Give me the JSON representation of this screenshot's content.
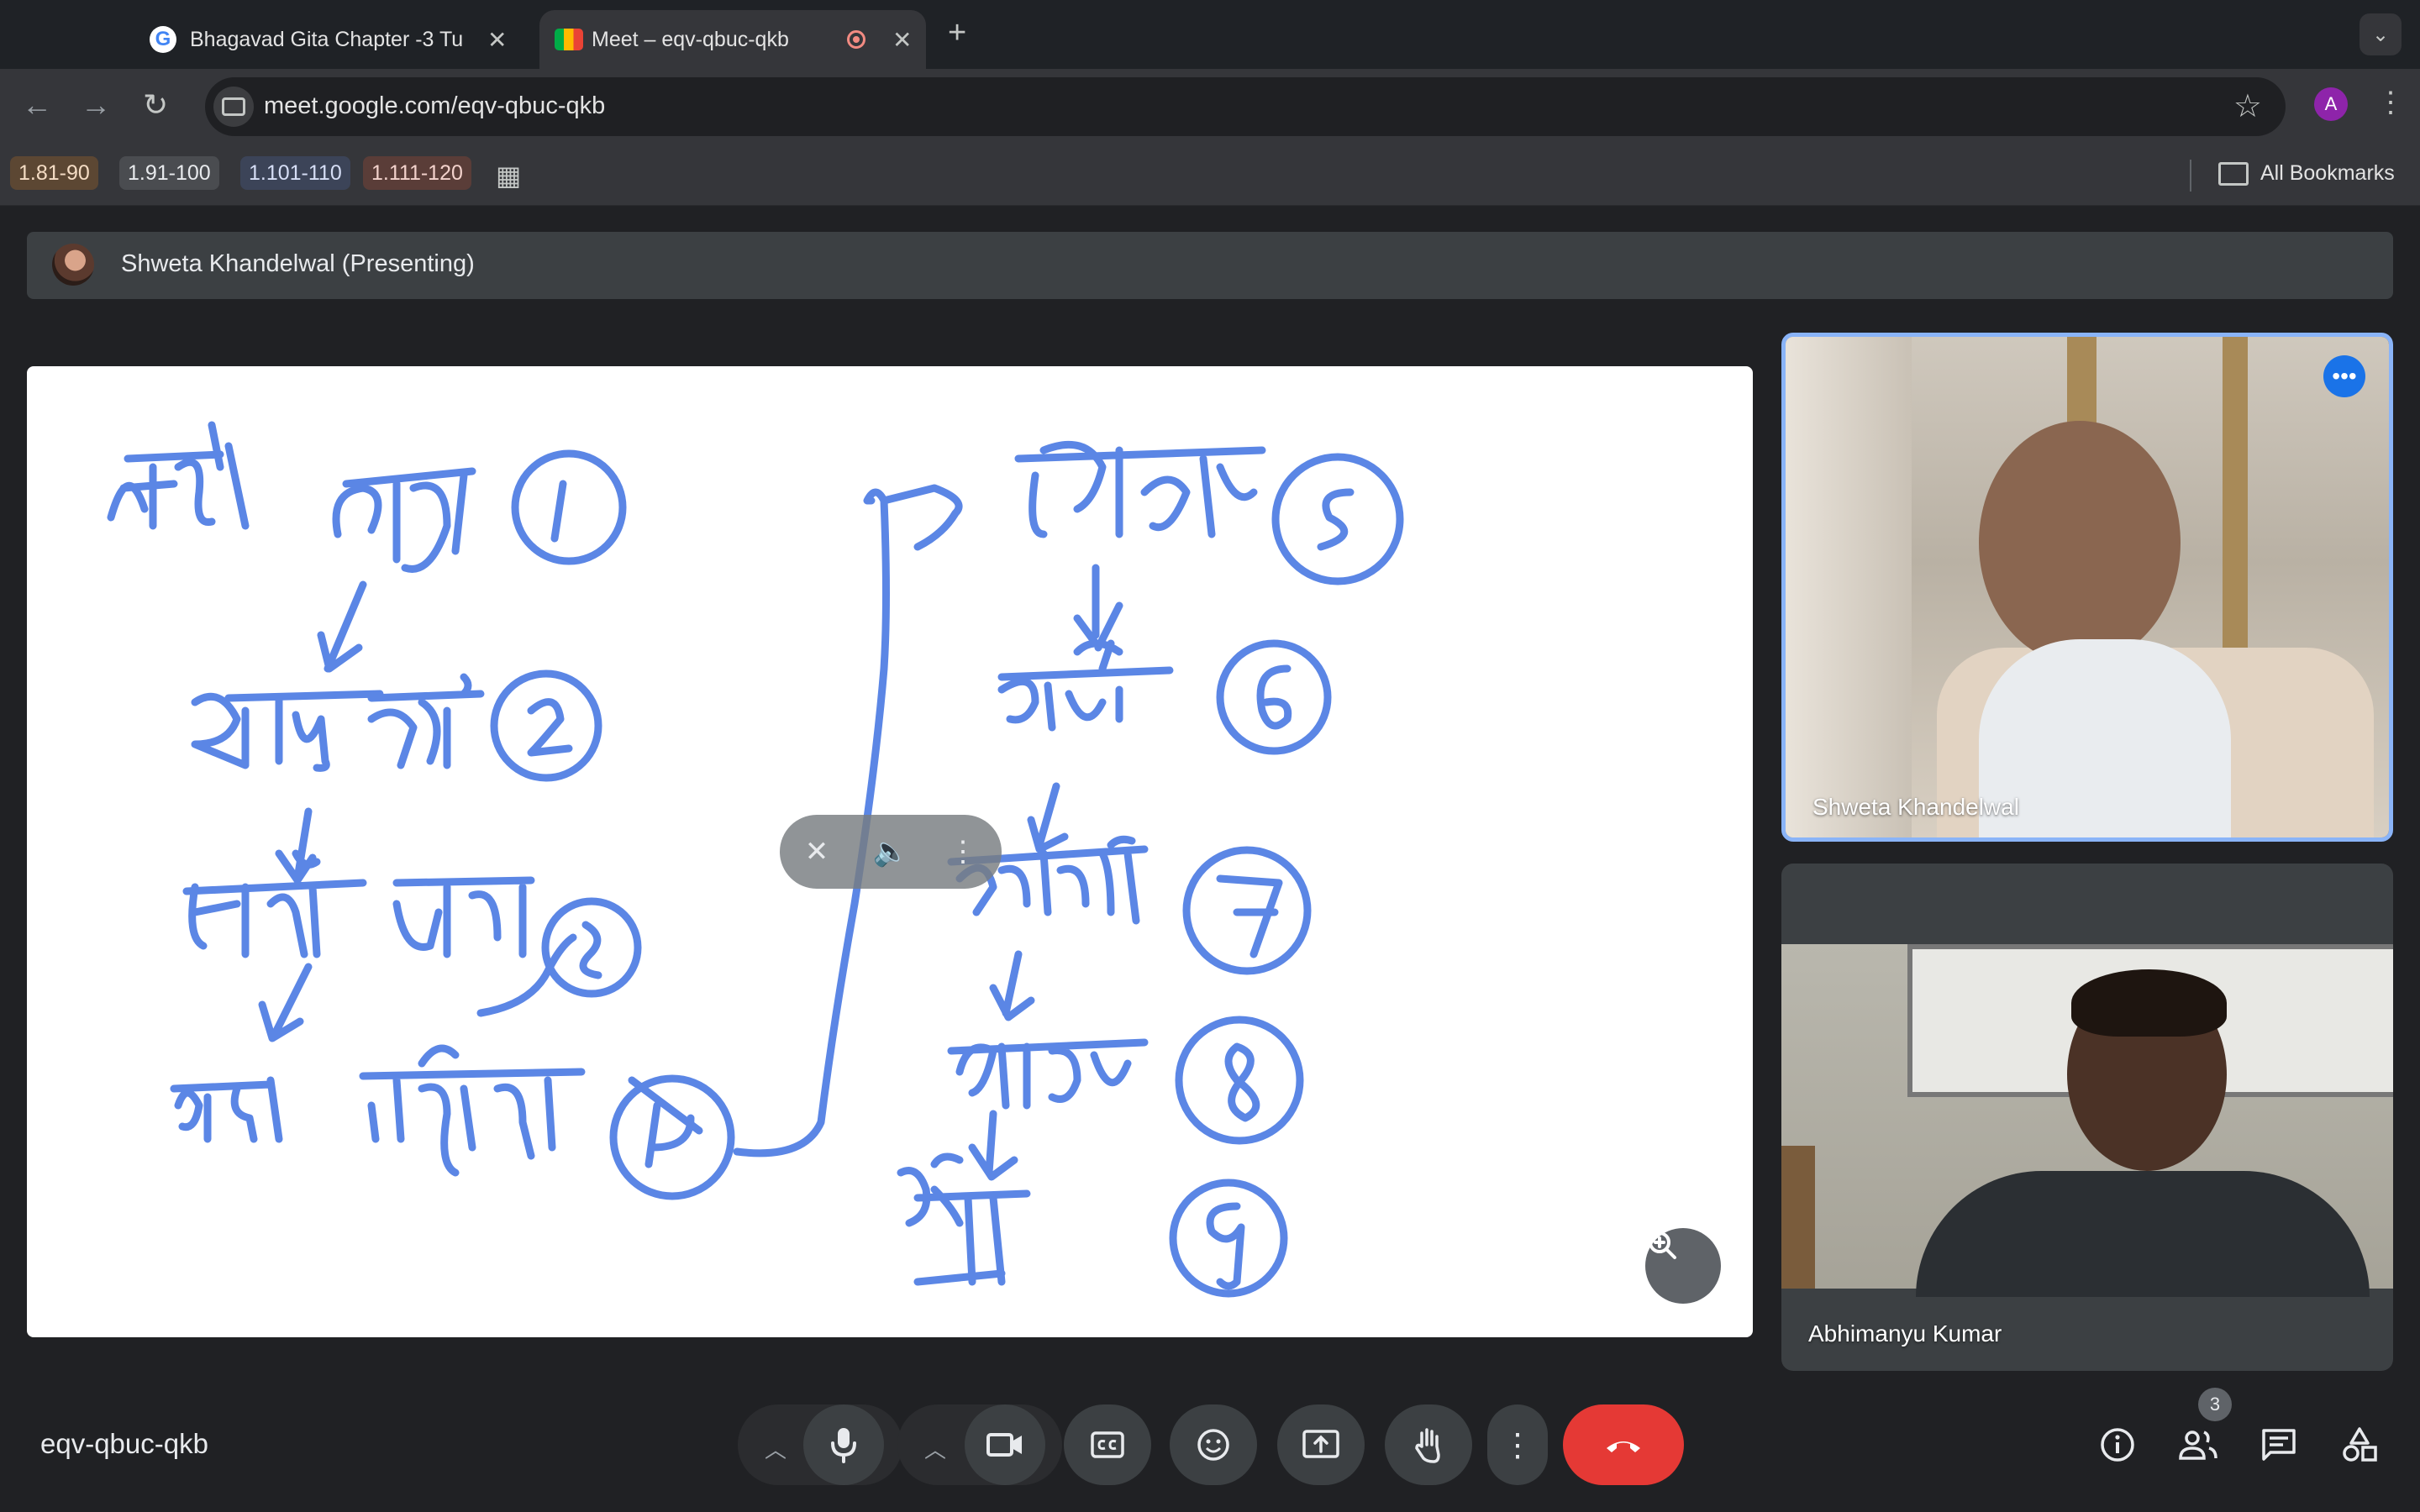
{
  "browser": {
    "tabs": [
      {
        "title": "Bhagavad Gita Chapter -3 Tu",
        "active": false
      },
      {
        "title": "Meet – eqv-qbuc-qkb",
        "active": true
      }
    ],
    "url": "meet.google.com/eqv-qbuc-qkb",
    "profile_initial": "A",
    "bookmarks": [
      "1.81-90",
      "1.91-100",
      "1.101-110",
      "1.111-120"
    ],
    "all_bookmarks_label": "All Bookmarks"
  },
  "meet": {
    "presenting_label": "Shweta Khandelwal (Presenting)",
    "whiteboard": {
      "ink_color": "#5b86e5",
      "handwritten_circled_numbers": [
        "1",
        "2",
        "3",
        "4",
        "5",
        "6",
        "7",
        "8",
        "9"
      ]
    },
    "participants": [
      {
        "name": "Shweta Khandelwal",
        "active_speaker": true
      },
      {
        "name": "Abhimanyu Kumar",
        "active_speaker": false
      }
    ],
    "meeting_code": "eqv-qbuc-qkb",
    "people_count": "3",
    "colors": {
      "end_call": "#e53935",
      "active_tile_border": "#8ab4f8",
      "accent": "#1a73e8"
    }
  }
}
